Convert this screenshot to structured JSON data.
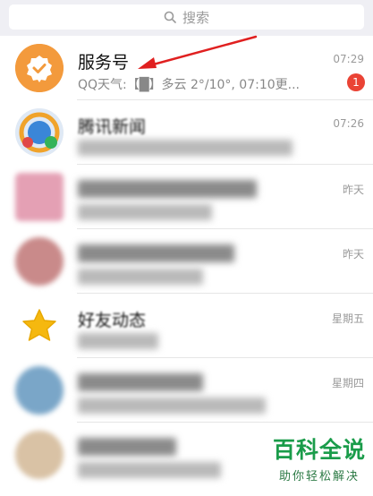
{
  "search": {
    "placeholder": "搜索",
    "icon": "search-icon"
  },
  "chats": [
    {
      "name": "服务号",
      "preview": "QQ天气:【█】多云 2°/10°, 07:10更...",
      "time": "07:29",
      "badge": "1",
      "avatar_color": "#f39a3c"
    },
    {
      "name": "腾讯新闻",
      "preview": "",
      "time": "07:26"
    },
    {
      "name": "",
      "preview": "",
      "time": "昨天"
    },
    {
      "name": "",
      "preview": "",
      "time": "昨天"
    },
    {
      "name": "好友动态",
      "preview": "",
      "time": "星期五",
      "avatar_color": "#f5b80f"
    },
    {
      "name": "",
      "preview": "",
      "time": "星期四"
    },
    {
      "name": "",
      "preview": "",
      "time": ""
    }
  ],
  "watermark": {
    "main": "百科全说",
    "sub": "助你轻松解决"
  },
  "colors": {
    "accent_red": "#ea4335",
    "arrow_red": "#e02020",
    "watermark_green": "#1a9c4a"
  }
}
